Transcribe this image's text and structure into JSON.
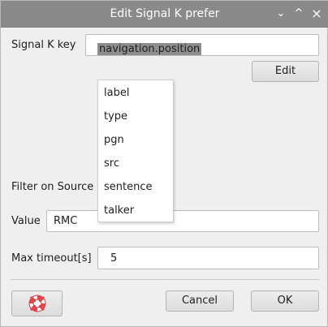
{
  "window": {
    "title": "Edit Signal K prefer",
    "controls": {
      "minimize": "⌄",
      "maximize": "^",
      "close": "×"
    }
  },
  "form": {
    "key_label": "Signal K key",
    "key_value": "navigation.position",
    "edit_button": "Edit",
    "filter_label": "Filter on Source",
    "value_label": "Value",
    "value_field": "RMC",
    "timeout_label": "Max timeout[s]",
    "timeout_value": "5"
  },
  "dropdown": {
    "items": [
      "label",
      "type",
      "pgn",
      "src",
      "sentence",
      "talker"
    ]
  },
  "footer": {
    "help_icon": "lifebuoy-icon",
    "cancel_button": "Cancel",
    "ok_button": "OK"
  },
  "colors": {
    "titlebar": "#8a8a8a",
    "selection": "#8e8e8e",
    "lifebuoy_red": "#e0474c"
  }
}
